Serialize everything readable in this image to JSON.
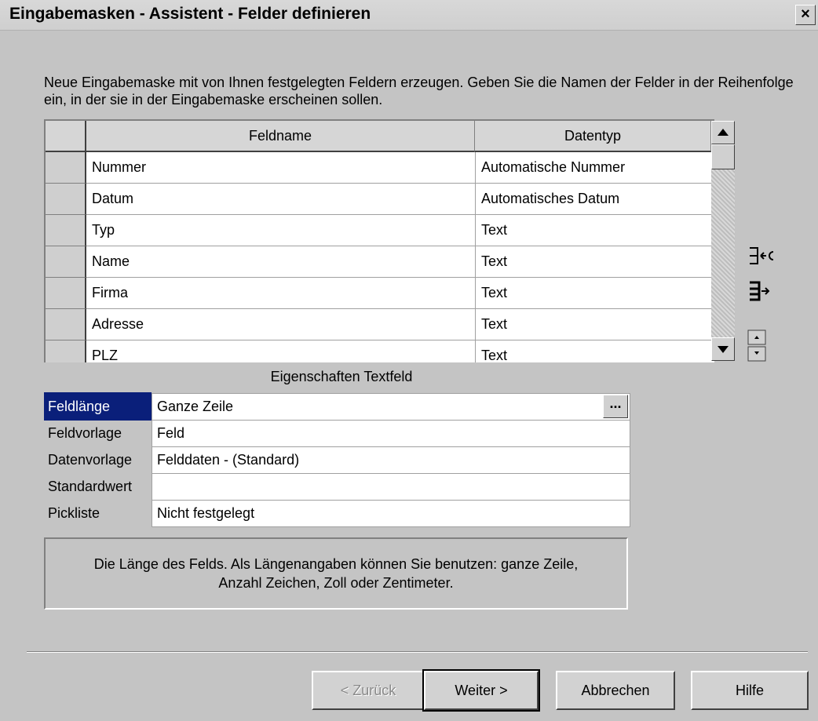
{
  "window": {
    "title": "Eingabemasken - Assistent - Felder definieren",
    "close_label": "×"
  },
  "intro_text": "Neue Eingabemaske mit von Ihnen festgelegten Feldern erzeugen. Geben Sie die Namen der Felder in der Reihenfolge ein, in der sie in der Eingabemaske erscheinen sollen.",
  "fields_table": {
    "columns": [
      "Feldname",
      "Datentyp"
    ],
    "rows": [
      {
        "name": "Nummer",
        "type": "Automatische Nummer"
      },
      {
        "name": "Datum",
        "type": "Automatisches Datum"
      },
      {
        "name": "Typ",
        "type": "Text"
      },
      {
        "name": "Name",
        "type": "Text"
      },
      {
        "name": "Firma",
        "type": "Text"
      },
      {
        "name": "Adresse",
        "type": "Text"
      },
      {
        "name": "PLZ",
        "type": "Text"
      }
    ]
  },
  "side_buttons": [
    "delete-field-icon",
    "insert-field-icon",
    "move-field-icon"
  ],
  "properties": {
    "caption": "Eigenschaften Textfeld",
    "rows": [
      {
        "label": "Feldlänge",
        "value": "Ganze Zeile"
      },
      {
        "label": "Feldvorlage",
        "value": "Feld"
      },
      {
        "label": "Datenvorlage",
        "value": "Felddaten - (Standard)"
      },
      {
        "label": "Standardwert",
        "value": ""
      },
      {
        "label": "Pickliste",
        "value": "Nicht festgelegt"
      }
    ],
    "ellipsis_label": "..."
  },
  "description": {
    "line1": "Die Länge des Felds. Als Längenangaben können Sie benutzen: ganze Zeile,",
    "line2": "Anzahl Zeichen, Zoll oder Zentimeter."
  },
  "buttons": {
    "back": "< Zurück",
    "next": "Weiter >",
    "cancel": "Abbrechen",
    "help": "Hilfe"
  },
  "colors": {
    "selection": "#0a1f7a",
    "dialog_bg": "#c4c4c4"
  }
}
